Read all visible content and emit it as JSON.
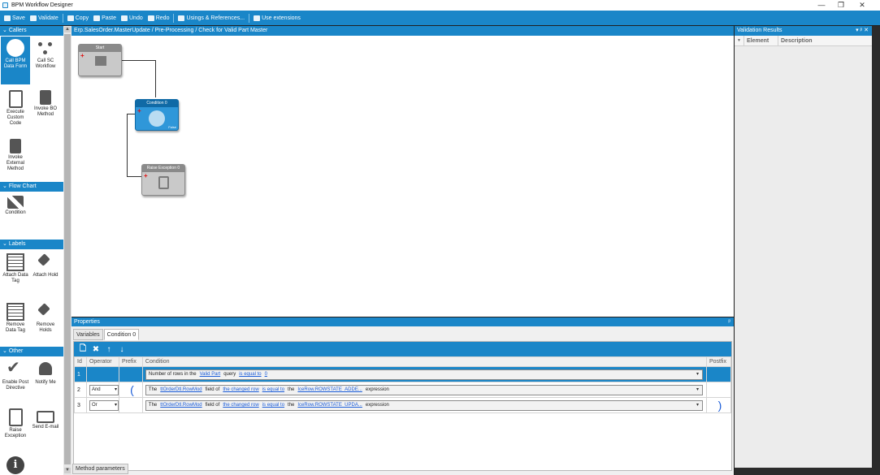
{
  "window": {
    "title": "BPM Workflow Designer",
    "controls": {
      "minimize": "—",
      "maximize": "❐",
      "close": "✕"
    }
  },
  "toolbar": {
    "save": "Save",
    "validate": "Validate",
    "copy": "Copy",
    "paste": "Paste",
    "undo": "Undo",
    "redo": "Redo",
    "usings": "Usings & References...",
    "extensions": "Use extensions"
  },
  "toolbox": {
    "groups": {
      "callers": "Callers",
      "flowchart": "Flow Chart",
      "labels": "Labels",
      "other": "Other"
    },
    "scroll_up": "▲",
    "scroll_down": "▼",
    "tools": {
      "call_bpm_data_form": "Call BPM Data Form",
      "call_sc_workflow": "Call SC Workflow",
      "execute_custom_code": "Execute Custom Code",
      "invoke_bo_method": "Invoke BO Method",
      "invoke_external_method": "Invoke External Method",
      "condition": "Condition",
      "attach_data_tag": "Attach Data Tag",
      "attach_hold": "Attach Hold",
      "remove_data_tag": "Remove Data Tag",
      "remove_holds": "Remove Holds",
      "enable_post_directive": "Enable Post Directive",
      "notify_me": "Notify Me",
      "raise_exception": "Raise Exception",
      "send_email": "Send E-mail",
      "info": "i"
    }
  },
  "designer": {
    "breadcrumb": "Erp.SalesOrder.MasterUpdate / Pre-Processing / Check for Valid Part Master",
    "nodes": {
      "start": "Start",
      "condition": "Condition 0",
      "condition_false": "False",
      "raise": "Raise Exception 0",
      "plus": "+"
    }
  },
  "properties": {
    "title": "Properties",
    "pin": "ᵖ",
    "tabs": [
      "Variables",
      "Condition 0"
    ],
    "grid_toolbar": {
      "new": "🗋",
      "delete": "✖",
      "up": "↑",
      "down": "↓"
    },
    "columns": [
      "Id",
      "Operator",
      "Prefix",
      "Condition",
      "Postfix"
    ],
    "rows": [
      {
        "id": "1",
        "operator": "",
        "prefix": "",
        "postfix": "",
        "parts": [
          "Number of rows in the",
          "Valid Part",
          "query",
          "is equal to",
          "0"
        ]
      },
      {
        "id": "2",
        "operator": "And",
        "prefix": "(",
        "postfix": "",
        "parts": [
          "The",
          "ttOrderDtl.RowMod",
          "field of",
          "the changed row",
          "is equal to",
          "the",
          "IceRow.ROWSTATE_ADDE...",
          "expression"
        ]
      },
      {
        "id": "3",
        "operator": "Or",
        "prefix": "",
        "postfix": ")",
        "parts": [
          "The",
          "ttOrderDtl.RowMod",
          "field of",
          "the changed row",
          "is equal to",
          "the",
          "IceRow.ROWSTATE_UPDA...",
          "expression"
        ]
      }
    ],
    "dropdown_glyph": "▾",
    "bottom_tab": "Method parameters"
  },
  "validation": {
    "title": "Validation Results",
    "pin": "▾ ᵖ ✕",
    "filter_glyph": "▼",
    "columns": [
      "Element",
      "Description"
    ]
  }
}
